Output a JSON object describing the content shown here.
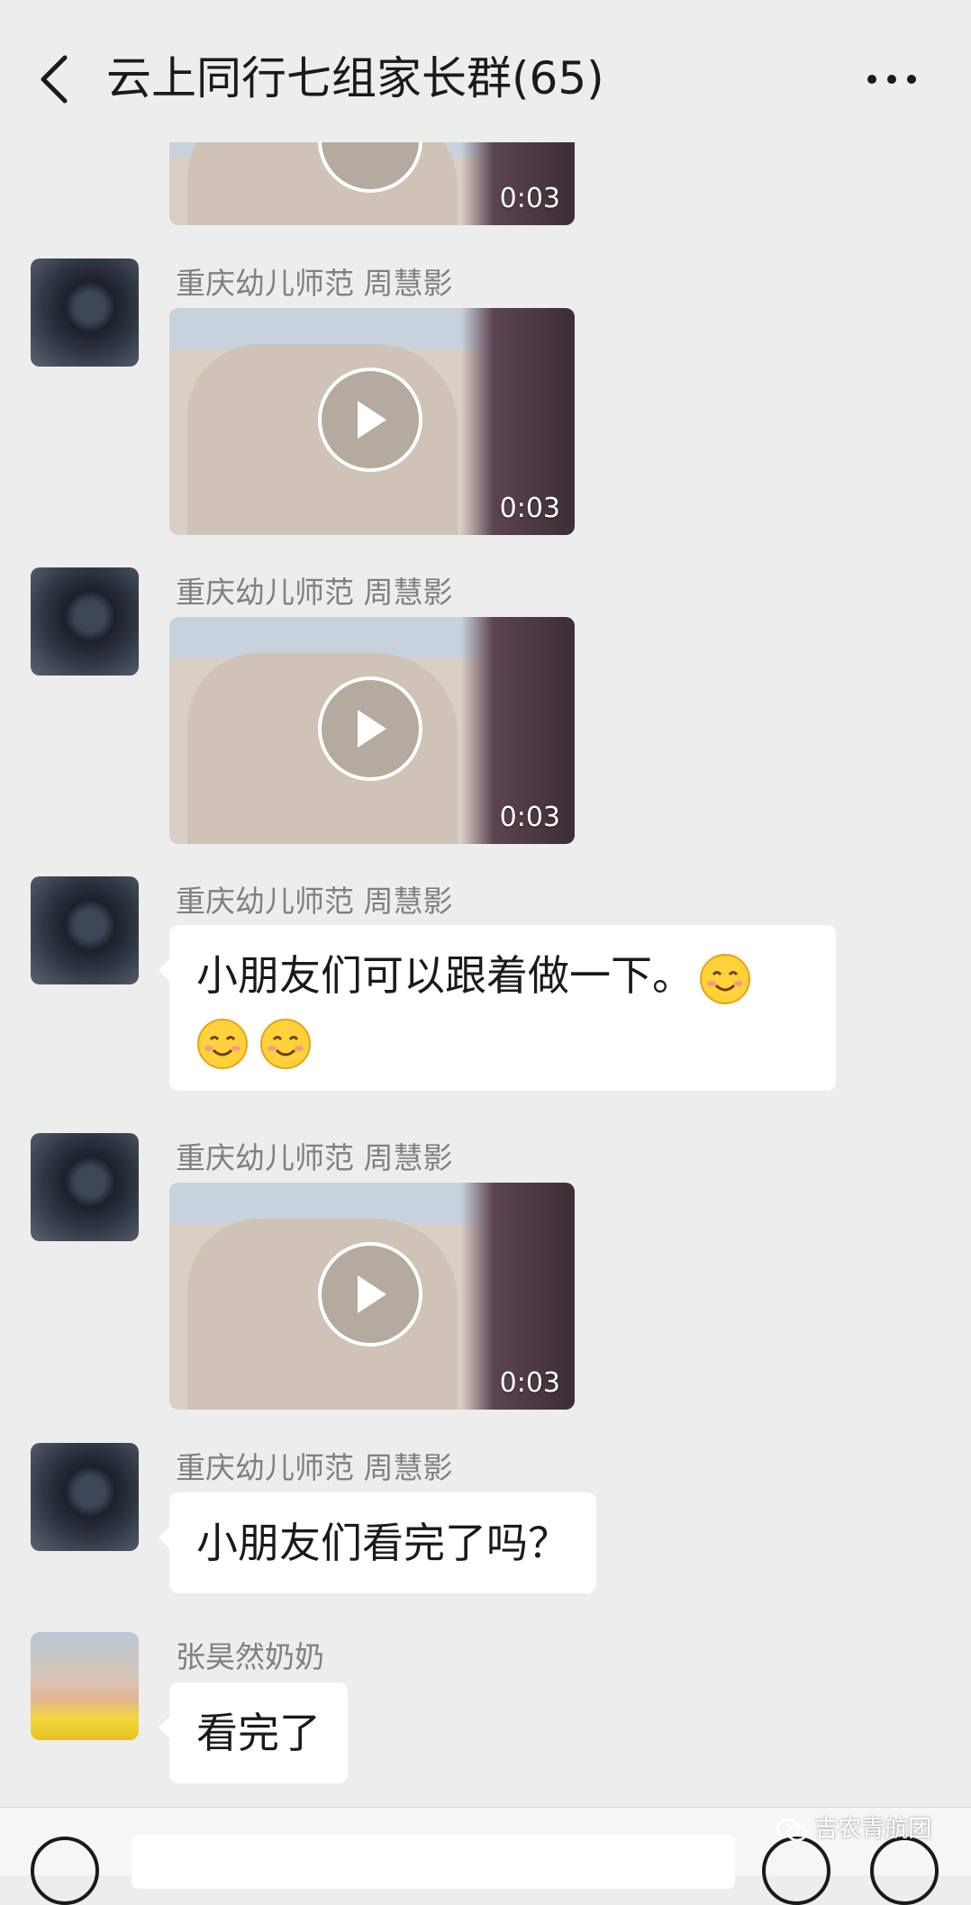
{
  "header": {
    "title": "云上同行七组家长群(65)"
  },
  "messages": [
    {
      "sender": "重庆幼儿师范  周慧影",
      "duration": "0:03"
    },
    {
      "sender": "重庆幼儿师范  周慧影",
      "duration": "0:03"
    },
    {
      "sender": "重庆幼儿师范  周慧影",
      "text": "小朋友们可以跟着做一下。"
    },
    {
      "sender": "重庆幼儿师范  周慧影",
      "duration": "0:03"
    },
    {
      "sender": "重庆幼儿师范  周慧影",
      "text": "小朋友们看完了吗？"
    },
    {
      "sender": "张昊然奶奶",
      "text": "看完了"
    }
  ],
  "partial_video": {
    "duration": "0:03"
  },
  "watermark": "吉农青航团",
  "colors": {
    "background": "#ededed",
    "bubble": "#ffffff",
    "sender": "#808080"
  },
  "icons": [
    "back-icon",
    "more-icon",
    "play-icon",
    "smile-emoji",
    "voice-icon",
    "emoji-icon",
    "plus-icon",
    "wechat-logo-icon"
  ]
}
